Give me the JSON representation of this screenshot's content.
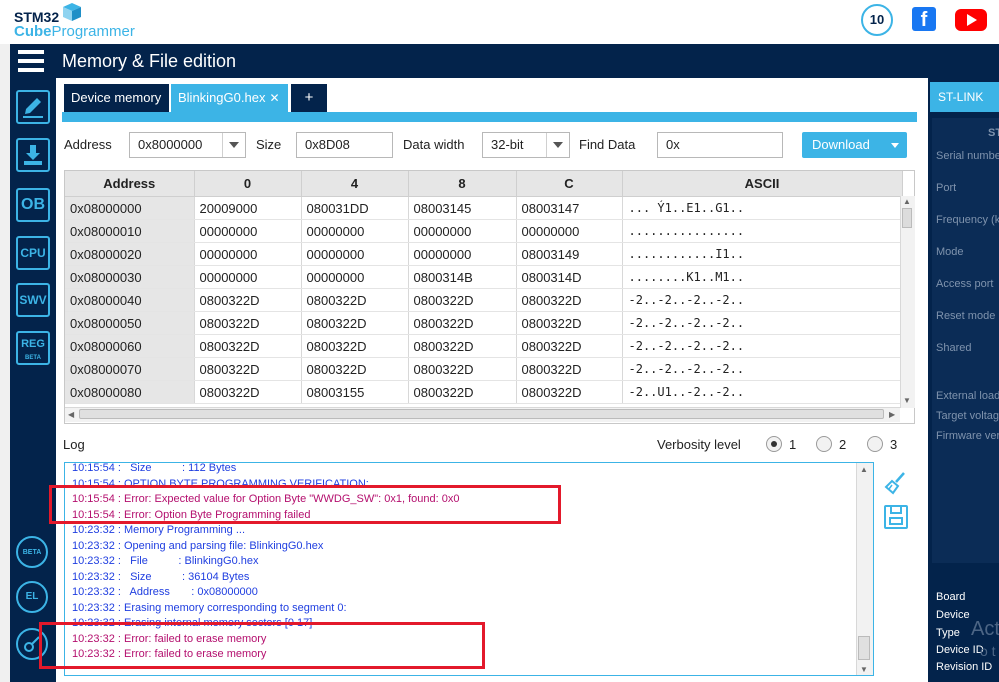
{
  "header": {
    "logo_line1": "STM32",
    "logo_line2_bold": "Cube",
    "logo_line2_thin": "Programmer",
    "badge_text": "10"
  },
  "title_bar": {
    "title": "Memory & File edition"
  },
  "sidebar": {
    "items": [
      {
        "name": "erasing-programming",
        "label": "",
        "icon": "pencil-icon"
      },
      {
        "name": "download",
        "label": "",
        "icon": "download-icon"
      },
      {
        "name": "option-bytes",
        "label": "OB",
        "icon": "ob-icon"
      },
      {
        "name": "cpu",
        "label": "CPU",
        "icon": "cpu-icon"
      },
      {
        "name": "swv",
        "label": "SWV",
        "icon": "swv-icon"
      },
      {
        "name": "reg",
        "label": "REG",
        "sub": "BETA",
        "icon": "reg-icon"
      }
    ],
    "bottom_items": [
      {
        "label": "BETA",
        "icon": "beta-bug-icon"
      },
      {
        "label": "EL",
        "icon": "external-loader-icon"
      },
      {
        "label": "",
        "icon": "key-icon"
      }
    ]
  },
  "tabs": [
    {
      "label": "Device memory",
      "active": false
    },
    {
      "label": "BlinkingG0.hex",
      "active": true
    },
    {
      "label": "+",
      "active": false
    }
  ],
  "address_bar": {
    "address_label": "Address",
    "address_value": "0x8000000",
    "size_label": "Size",
    "size_value": "0x8D08",
    "width_label": "Data width",
    "width_value": "32-bit",
    "find_label": "Find Data",
    "find_value": "0x",
    "download_label": "Download"
  },
  "memory_table": {
    "columns": [
      "Address",
      "0",
      "4",
      "8",
      "C",
      "ASCII"
    ],
    "rows": [
      [
        "0x08000000",
        "20009000",
        "080031DD",
        "08003145",
        "08003147",
        "... Ý1..E1..G1.."
      ],
      [
        "0x08000010",
        "00000000",
        "00000000",
        "00000000",
        "00000000",
        "................"
      ],
      [
        "0x08000020",
        "00000000",
        "00000000",
        "00000000",
        "08003149",
        "............I1.."
      ],
      [
        "0x08000030",
        "00000000",
        "00000000",
        "0800314B",
        "0800314D",
        "........K1..M1.."
      ],
      [
        "0x08000040",
        "0800322D",
        "0800322D",
        "0800322D",
        "0800322D",
        "-2..-2..-2..-2.."
      ],
      [
        "0x08000050",
        "0800322D",
        "0800322D",
        "0800322D",
        "0800322D",
        "-2..-2..-2..-2.."
      ],
      [
        "0x08000060",
        "0800322D",
        "0800322D",
        "0800322D",
        "0800322D",
        "-2..-2..-2..-2.."
      ],
      [
        "0x08000070",
        "0800322D",
        "0800322D",
        "0800322D",
        "0800322D",
        "-2..-2..-2..-2.."
      ],
      [
        "0x08000080",
        "0800322D",
        "08003155",
        "0800322D",
        "0800322D",
        "-2..U1..-2..-2.."
      ]
    ]
  },
  "log": {
    "label": "Log",
    "verbosity_label": "Verbosity level",
    "levels": [
      "1",
      "2",
      "3"
    ],
    "selected_level": "1",
    "lines": [
      {
        "text": "10:15:54 :   Size          : 112 Bytes",
        "type": "info"
      },
      {
        "text": "10:15:54 : OPTION BYTE PROGRAMMING VERIFICATION:",
        "type": "info"
      },
      {
        "text": "10:15:54 : Error: Expected value for Option Byte \"WWDG_SW\": 0x1, found: 0x0",
        "type": "error"
      },
      {
        "text": "10:15:54 : Error: Option Byte Programming failed",
        "type": "error"
      },
      {
        "text": "10:23:32 : Memory Programming ...",
        "type": "info"
      },
      {
        "text": "10:23:32 : Opening and parsing file: BlinkingG0.hex",
        "type": "info"
      },
      {
        "text": "10:23:32 :   File          : BlinkingG0.hex",
        "type": "info"
      },
      {
        "text": "10:23:32 :   Size          : 36104 Bytes",
        "type": "info"
      },
      {
        "text": "10:23:32 :   Address       : 0x08000000",
        "type": "info"
      },
      {
        "text": "10:23:32 : Erasing memory corresponding to segment 0:",
        "type": "info"
      },
      {
        "text": "10:23:32 : Erasing internal memory sectors [0 17]",
        "type": "info"
      },
      {
        "text": "10:23:32 : Error: failed to erase memory",
        "type": "error"
      },
      {
        "text": "10:23:32 : Error: failed to erase memory",
        "type": "error"
      }
    ]
  },
  "right_panel": {
    "tab_label": "ST-LINK",
    "section_header": "ST",
    "fields": [
      "Serial number",
      "Port",
      "Frequency (k",
      "Mode",
      "Access port",
      "Reset mode",
      "Shared",
      "External load",
      "Target voltag",
      "Firmware ver"
    ],
    "device_fields": [
      "Board",
      "Device",
      "Type",
      "Device ID",
      "Revision ID"
    ],
    "watermark_line1": "Act",
    "watermark_line2": "o t"
  },
  "colors": {
    "navy": "#03234b",
    "accent": "#3cb4e6",
    "error_text": "#b40f6e",
    "info_text": "#1f3ee0",
    "highlight_box": "#e3192b"
  }
}
